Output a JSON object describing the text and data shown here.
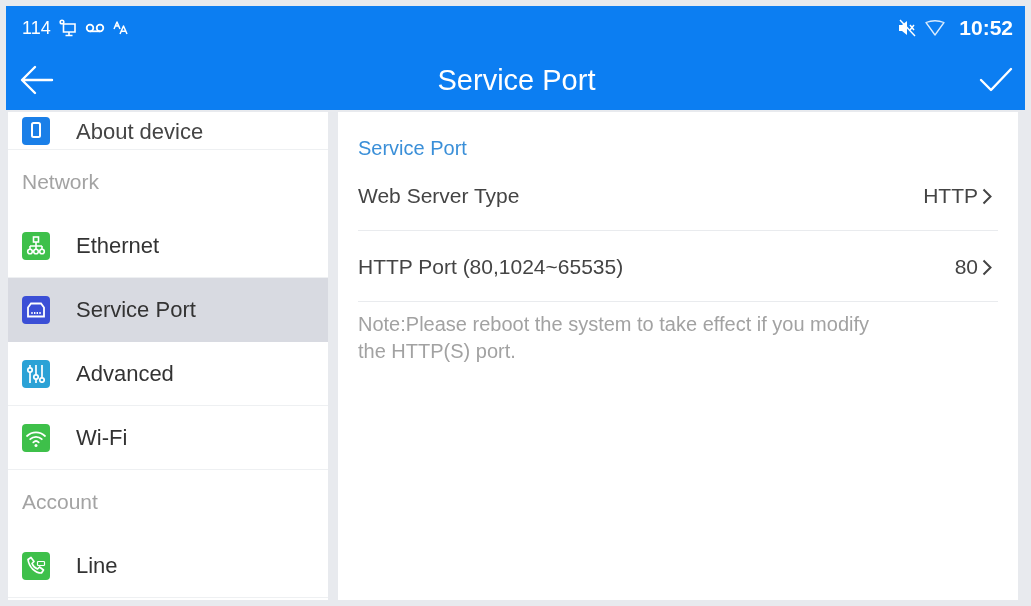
{
  "status_bar": {
    "extension": "114",
    "time": "10:52"
  },
  "header": {
    "title": "Service Port"
  },
  "sidebar": {
    "items": [
      {
        "kind": "item",
        "label": "About device",
        "color": "#1a7fe8",
        "selected": false
      },
      {
        "kind": "header",
        "label": "Network"
      },
      {
        "kind": "item",
        "label": "Ethernet",
        "color": "#3ec04a",
        "selected": false
      },
      {
        "kind": "item",
        "label": "Service Port",
        "color": "#3b4fd6",
        "selected": true
      },
      {
        "kind": "item",
        "label": "Advanced",
        "color": "#2ba2d6",
        "selected": false
      },
      {
        "kind": "item",
        "label": "Wi-Fi",
        "color": "#3ec04a",
        "selected": false
      },
      {
        "kind": "header",
        "label": "Account"
      },
      {
        "kind": "item",
        "label": "Line",
        "color": "#3ec04a",
        "selected": false
      }
    ]
  },
  "content": {
    "section_title": "Service Port",
    "rows": [
      {
        "label": "Web Server Type",
        "value": "HTTP"
      },
      {
        "label": "HTTP Port (80,1024~65535)",
        "value": "80"
      }
    ],
    "note": "Note:Please reboot the system to take effect if you modify the HTTP(S) port."
  }
}
